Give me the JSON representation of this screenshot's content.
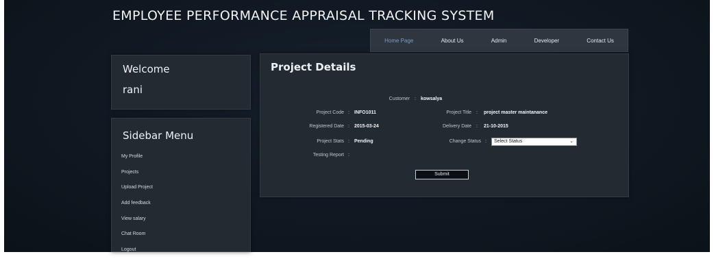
{
  "app": {
    "title": "EMPLOYEE PERFORMANCE APPRAISAL TRACKING SYSTEM"
  },
  "nav": {
    "items": [
      "Home Page",
      "About Us",
      "Admin",
      "Developer",
      "Contact Us"
    ],
    "active": "Home Page"
  },
  "welcome": {
    "label": "Welcome",
    "user": "rani"
  },
  "sidebar": {
    "heading": "Sidebar Menu",
    "items": [
      "My Profile",
      "Projects",
      "Upload Project",
      "Add feedback",
      "View salary",
      "Chat Room",
      "Logout"
    ]
  },
  "project": {
    "heading": "Project Details",
    "customer_label": "Customer",
    "customer": "kowsalya",
    "code_label": "Project Code",
    "code": "INFO1011",
    "title_label": "Project Title",
    "title": "project master maintanance",
    "registered_label": "Registered Date",
    "registered": "2015-03-24",
    "delivery_label": "Delivery Date",
    "delivery": "21-10-2015",
    "stats_label": "Project Stats",
    "stats": "Pending",
    "change_status_label": "Change Status",
    "status_select": "Select Status",
    "testing_label": "Testing Report",
    "submit": "Submit"
  },
  "colors": {
    "background": "#0f1822",
    "panel": "#222a32",
    "nav_active": "#7e9bbf"
  }
}
